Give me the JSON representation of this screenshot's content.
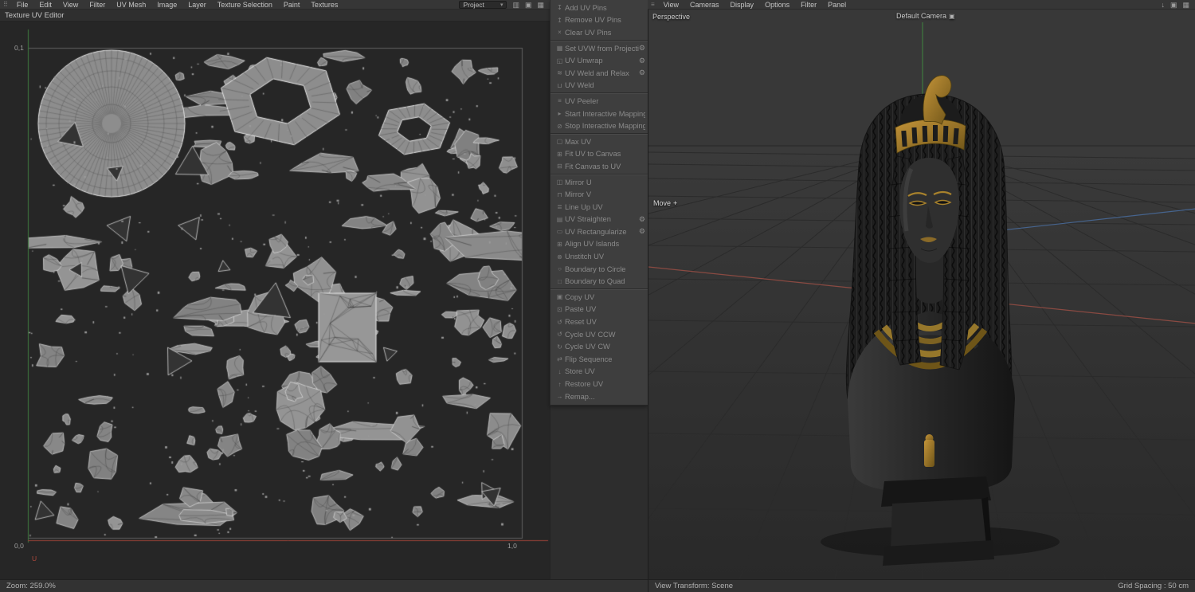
{
  "colors": {
    "gold": "#a8842e",
    "u_axis_red": "#9c4238",
    "v_axis_green": "#3f7a3f",
    "x_axis_red": "#8a4a42",
    "z_axis_blue": "#46648e"
  },
  "left_panel": {
    "menu_items": [
      "File",
      "Edit",
      "View",
      "Filter",
      "UV Mesh",
      "Image",
      "Layer",
      "Texture Selection",
      "Paint",
      "Textures"
    ],
    "project_dropdown": "Project",
    "title": "Texture UV Editor",
    "coords": {
      "top_left": "0,1",
      "bottom_left": "0,0",
      "bottom_right": "1,0",
      "u_axis": "U"
    },
    "status_zoom": "Zoom: 259.0%"
  },
  "uv_palette": {
    "groups": [
      {
        "items": [
          {
            "label": "Add UV Pins",
            "icon": "pin-add-icon"
          },
          {
            "label": "Remove UV Pins",
            "icon": "pin-remove-icon"
          },
          {
            "label": "Clear UV Pins",
            "icon": "pin-clear-icon"
          }
        ]
      },
      {
        "items": [
          {
            "label": "Set UVW from Projection",
            "icon": "projection-icon",
            "gear": true
          },
          {
            "label": "UV Unwrap",
            "icon": "unwrap-icon",
            "gear": true
          },
          {
            "label": "UV Weld and Relax",
            "icon": "weld-relax-icon",
            "gear": true
          },
          {
            "label": "UV Weld",
            "icon": "weld-icon"
          }
        ]
      },
      {
        "items": [
          {
            "label": "UV Peeler",
            "icon": "peeler-icon"
          },
          {
            "label": "Start Interactive Mapping",
            "icon": "start-mapping-icon"
          },
          {
            "label": "Stop Interactive Mapping",
            "icon": "stop-mapping-icon"
          }
        ]
      },
      {
        "items": [
          {
            "label": "Max UV",
            "icon": "max-uv-icon"
          },
          {
            "label": "Fit UV to Canvas",
            "icon": "fit-uv-icon"
          },
          {
            "label": "Fit Canvas to UV",
            "icon": "fit-canvas-icon"
          }
        ]
      },
      {
        "items": [
          {
            "label": "Mirror U",
            "icon": "mirror-u-icon"
          },
          {
            "label": "Mirror V",
            "icon": "mirror-v-icon"
          },
          {
            "label": "Line Up UV",
            "icon": "line-up-icon"
          },
          {
            "label": "UV Straighten",
            "icon": "straighten-icon",
            "gear": true
          },
          {
            "label": "UV Rectangularize",
            "icon": "rectangularize-icon",
            "gear": true
          },
          {
            "label": "Align UV Islands",
            "icon": "align-islands-icon"
          },
          {
            "label": "Unstitch UV",
            "icon": "unstitch-icon"
          },
          {
            "label": "Boundary to Circle",
            "icon": "boundary-circle-icon"
          },
          {
            "label": "Boundary to Quad",
            "icon": "boundary-quad-icon"
          }
        ]
      },
      {
        "items": [
          {
            "label": "Copy UV",
            "icon": "copy-icon"
          },
          {
            "label": "Paste UV",
            "icon": "paste-icon"
          },
          {
            "label": "Reset UV",
            "icon": "reset-icon"
          },
          {
            "label": "Cycle UV CCW",
            "icon": "cycle-ccw-icon"
          },
          {
            "label": "Cycle UV CW",
            "icon": "cycle-cw-icon"
          },
          {
            "label": "Flip Sequence",
            "icon": "flip-sequence-icon"
          },
          {
            "label": "Store UV",
            "icon": "store-icon"
          },
          {
            "label": "Restore UV",
            "icon": "restore-icon"
          },
          {
            "label": "Remap...",
            "icon": "remap-icon"
          }
        ]
      }
    ]
  },
  "viewport": {
    "menu_items": [
      "View",
      "Cameras",
      "Display",
      "Options",
      "Filter",
      "Panel"
    ],
    "view_label": "Perspective",
    "camera_label": "Default Camera",
    "tool_tooltip": "Move",
    "status_left": "View Transform: Scene",
    "status_right": "Grid Spacing : 50 cm"
  }
}
